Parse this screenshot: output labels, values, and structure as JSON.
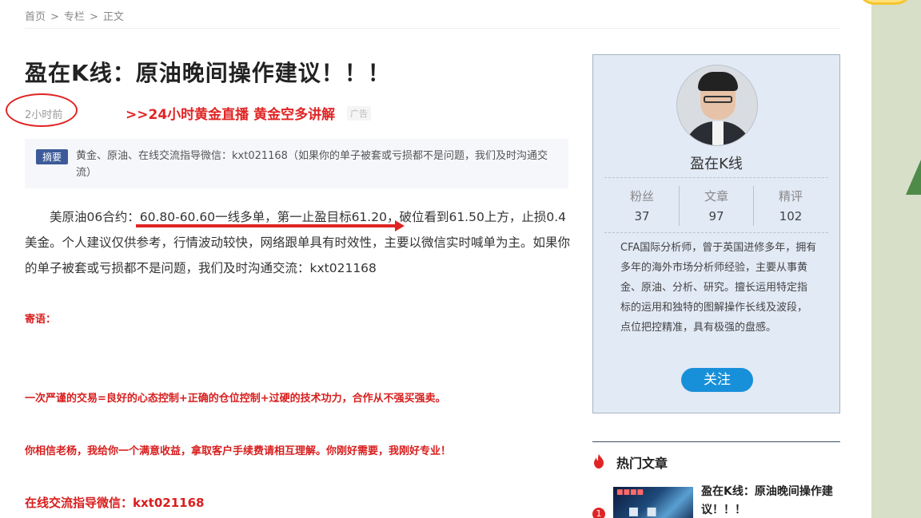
{
  "breadcrumb": {
    "home": "首页",
    "column": "专栏",
    "current": "正文",
    "separator": ">"
  },
  "article": {
    "title": "盈在K线：原油晚间操作建议！！！",
    "time_ago": "2小时前",
    "promo_link": ">>24小时黄金直播 黄金空多讲解",
    "ad_label": "广告",
    "summary_label": "摘要",
    "summary_text": "黄金、原油、在线交流指导微信：kxt021168（如果你的单子被套或亏损都不是问题，我们及时沟通交流）",
    "body_prefix": "美原油06合约：",
    "body_highlight": "60.80-60.60一线多单，第一止盈目标61.20，",
    "body_suffix": "破位看到61.50上方，止损0.4美金。个人建议仅供参考，行情波动较快，网络跟单具有时效性，主要以微信实时喊单为主。如果你的单子被套或亏损都不是问题，我们及时沟通交流：kxt021168",
    "note_label": "寄语：",
    "quote1": "一次严谨的交易=良好的心态控制+正确的仓位控制+过硬的技术功力，合作从不强买强卖。",
    "quote2": "你相信老杨，我给你一个满意收益，拿取客户手续费请相互理解。你刚好需要，我刚好专业！",
    "wechat_line": "在线交流指导微信：kxt021168"
  },
  "author": {
    "name": "盈在K线",
    "stats": [
      {
        "label": "粉丝",
        "value": "37"
      },
      {
        "label": "文章",
        "value": "97"
      },
      {
        "label": "精评",
        "value": "102"
      }
    ],
    "bio": "CFA国际分析师，曾于英国进修多年，拥有多年的海外市场分析师经验，主要从事黄金、原油、分析、研究。擅长运用特定指标的运用和独特的图解操作长线及波段，点位把控精准，具有极强的盘感。",
    "follow_label": "关注"
  },
  "hot": {
    "title": "热门文章",
    "items": [
      {
        "rank": "1",
        "title": "盈在K线：原油晚间操作建议！！！"
      }
    ]
  },
  "colors": {
    "accent_red": "#e02424",
    "follow_blue": "#1890d9",
    "summary_blue": "#3c5a99"
  },
  "icons": {
    "hot": "fire-icon"
  }
}
